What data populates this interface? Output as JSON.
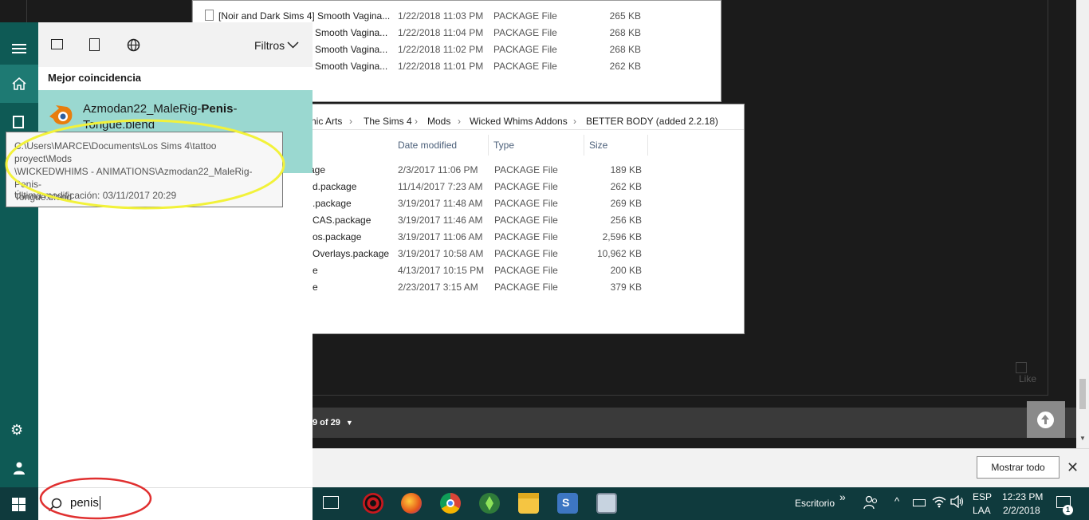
{
  "explorer_top": {
    "rows": [
      {
        "name": "[Noir and Dark Sims 4] Smooth Vagina...",
        "date": "1/22/2018 11:03 PM",
        "type": "PACKAGE File",
        "size": "265 KB"
      },
      {
        "name": "Smooth Vagina...",
        "date": "1/22/2018 11:04 PM",
        "type": "PACKAGE File",
        "size": "268 KB"
      },
      {
        "name": "Smooth Vagina...",
        "date": "1/22/2018 11:02 PM",
        "type": "PACKAGE File",
        "size": "268 KB"
      },
      {
        "name": "Smooth Vagina...",
        "date": "1/22/2018 11:01 PM",
        "type": "PACKAGE File",
        "size": "262 KB"
      }
    ]
  },
  "explorer_main": {
    "breadcrumb": [
      "nic Arts",
      "The Sims 4",
      "Mods",
      "Wicked Whims Addons",
      "BETTER BODY (added 2.2.18)"
    ],
    "columns": {
      "date": "Date modified",
      "type": "Type",
      "size": "Size"
    },
    "rows": [
      {
        "name": "age",
        "date": "2/3/2017 11:06 PM",
        "type": "PACKAGE File",
        "size": "189 KB"
      },
      {
        "name": "d.package",
        "date": "11/14/2017 7:23 AM",
        "type": "PACKAGE File",
        "size": "262 KB"
      },
      {
        "name": ".package",
        "date": "3/19/2017 11:48 AM",
        "type": "PACKAGE File",
        "size": "269 KB"
      },
      {
        "name": "CAS.package",
        "date": "3/19/2017 11:46 AM",
        "type": "PACKAGE File",
        "size": "256 KB"
      },
      {
        "name": "os.package",
        "date": "3/19/2017 11:06 AM",
        "type": "PACKAGE File",
        "size": "2,596 KB"
      },
      {
        "name": "Overlays.package",
        "date": "3/19/2017 10:58 AM",
        "type": "PACKAGE File",
        "size": "10,962 KB"
      },
      {
        "name": "e",
        "date": "4/13/2017 10:15 PM",
        "type": "PACKAGE File",
        "size": "200 KB"
      },
      {
        "name": "e",
        "date": "2/23/2017 3:15 AM",
        "type": "PACKAGE File",
        "size": "379 KB"
      }
    ]
  },
  "forum": {
    "like_label": "Like",
    "pager_text": "9 of 29"
  },
  "download_bar": {
    "show_all_label": "Mostrar todo",
    "close_glyph": "✕"
  },
  "search": {
    "filters_label": "Filtros",
    "best_match_heading": "Mejor coincidencia",
    "result": {
      "title_prefix": "Azmodan22_MaleRig-",
      "title_bold": "Penis",
      "title_suffix": "-Tongue.blend"
    },
    "tooltip": {
      "path": "C:\\Users\\MARCE\\Documents\\Los Sims 4\\tattoo proyect\\Mods\n\\WICKEDWHIMS - ANIMATIONS\\Azmodan22_MaleRig-Penis-\nTongue.blend",
      "modified": "Última modificación: 03/11/2017 20:29"
    },
    "query": "penis"
  },
  "taskbar": {
    "desktop_label": "Escritorio",
    "desktop_chevron": "»",
    "language_top": "ESP",
    "language_bottom": "LAA",
    "time": "12:23 PM",
    "date": "2/2/2018",
    "notification_count": "1"
  },
  "colors": {
    "rail": "#0e5a55",
    "highlight": "#9ad8d0",
    "taskbar": "#0f3a3d",
    "annotation_yellow": "#f2f23a",
    "annotation_red": "#e03030"
  }
}
